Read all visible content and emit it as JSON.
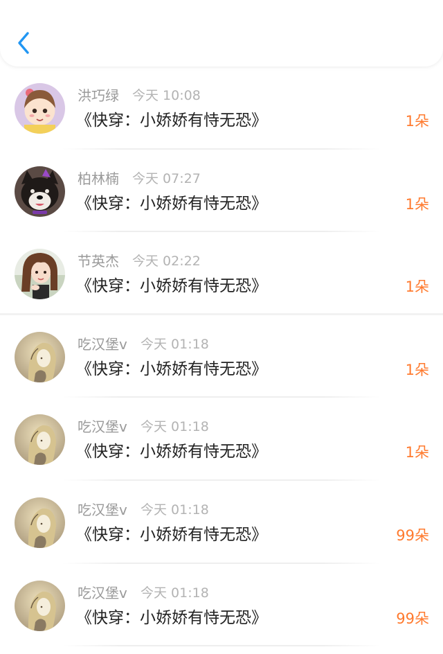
{
  "header": {
    "back_icon": "chevron-left-icon",
    "accent_color": "#2196f3"
  },
  "colors": {
    "name": "#9a9a9a",
    "time": "#b3b3b3",
    "title": "#222222",
    "amount": "#ff7a2e"
  },
  "rows": [
    {
      "name": "洪巧绿",
      "time": "今天 10:08",
      "title": "《快穿：小娇娇有恃无恐》",
      "amount": "1朵",
      "avatar": "cartoon-girl-avatar"
    },
    {
      "name": "柏林楠",
      "time": "今天 07:27",
      "title": "《快穿：小娇娇有恃无恐》",
      "amount": "1朵",
      "avatar": "dog-avatar"
    },
    {
      "name": "节英杰",
      "time": "今天 02:22",
      "title": "《快穿：小娇娇有恃无恐》",
      "amount": "1朵",
      "avatar": "photo-girl-avatar"
    },
    {
      "name": "吃汉堡v",
      "time": "今天 01:18",
      "title": "《快穿：小娇娇有恃无恐》",
      "amount": "1朵",
      "avatar": "sketch-girl-avatar"
    },
    {
      "name": "吃汉堡v",
      "time": "今天 01:18",
      "title": "《快穿：小娇娇有恃无恐》",
      "amount": "1朵",
      "avatar": "sketch-girl-avatar"
    },
    {
      "name": "吃汉堡v",
      "time": "今天 01:18",
      "title": "《快穿：小娇娇有恃无恐》",
      "amount": "99朵",
      "avatar": "sketch-girl-avatar"
    },
    {
      "name": "吃汉堡v",
      "time": "今天 01:18",
      "title": "《快穿：小娇娇有恃无恐》",
      "amount": "99朵",
      "avatar": "sketch-girl-avatar"
    }
  ]
}
